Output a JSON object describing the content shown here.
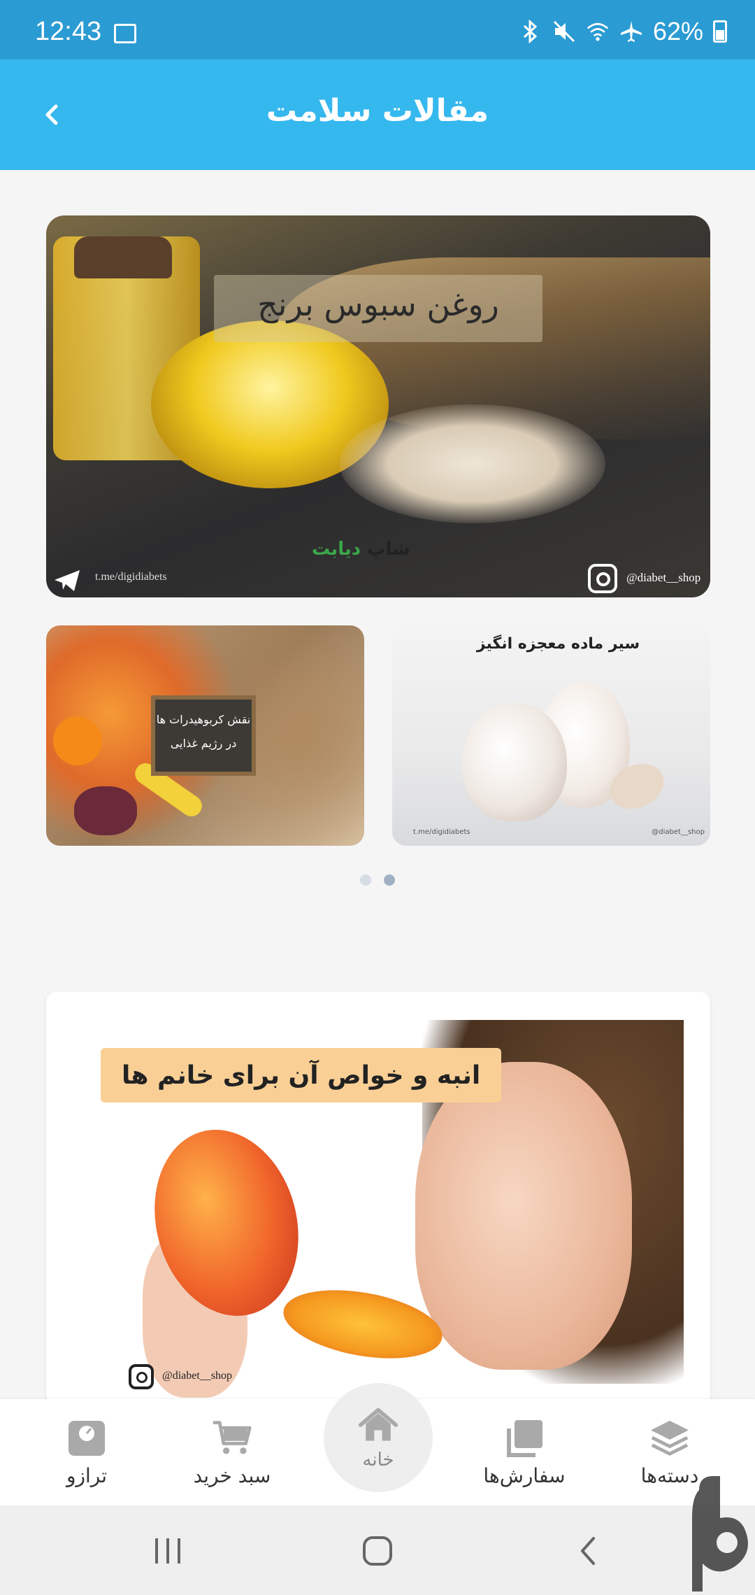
{
  "status_bar": {
    "time": "12:43",
    "battery": "62%"
  },
  "app_bar": {
    "title": "مقالات سلامت"
  },
  "slider": {
    "hero": {
      "title": "روغن سبوس برنج",
      "brand_prefix": "دیابت",
      "brand_suffix": "شاپ",
      "telegram": "t.me/digidiabets",
      "instagram": "@diabet__shop"
    },
    "cards": [
      {
        "title": "نقش کربوهیدرات ها در رژیم غذایی",
        "line1": "نقش کربوهیدرات ها",
        "line2": "در رژیم غذایی"
      },
      {
        "title": "سیر ماده معجزه انگیز",
        "telegram": "t.me/digidiabets",
        "instagram": "@diabet__shop"
      }
    ],
    "dots": [
      false,
      true
    ]
  },
  "article": {
    "title": "انبه و خواص آن برای خانم ها",
    "instagram": "@diabet__shop"
  },
  "bottom_nav": {
    "items": [
      {
        "label": "ترازو",
        "icon": "scale-icon"
      },
      {
        "label": "سبد خرید",
        "icon": "cart-icon"
      },
      {
        "label": "خانه",
        "icon": "home-icon"
      },
      {
        "label": "سفارش‌ها",
        "icon": "orders-icon"
      },
      {
        "label": "دسته‌ها",
        "icon": "layers-icon"
      }
    ]
  },
  "colors": {
    "status_bar": "#2b9bd3",
    "app_bar": "#35b8ee",
    "article_label": "#f9cf96"
  }
}
